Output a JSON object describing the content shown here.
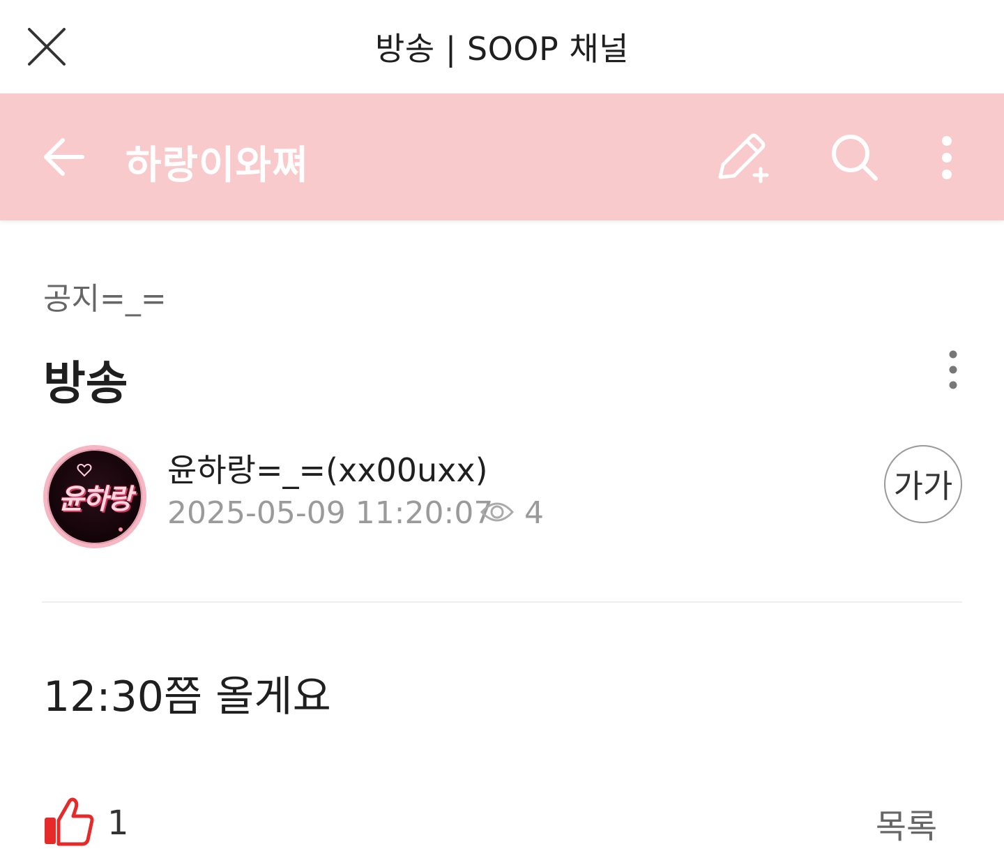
{
  "window": {
    "title": "방송 | SOOP 채널"
  },
  "channel_header": {
    "name": "하랑이와쪄",
    "background_color": "#f9cacb",
    "icons": [
      "back-arrow-icon",
      "write-post-icon",
      "search-icon",
      "more-vertical-icon"
    ]
  },
  "post": {
    "category": "공지=_=",
    "title": "방송",
    "author": "윤하랑=_=(xx00uxx)",
    "avatar_text": "윤하랑",
    "date": "2025-05-09 11:20:07",
    "views": "4",
    "font_size_label": "가가",
    "body": "12:30쯤 올게요",
    "likes": "1",
    "list_label": "목록"
  },
  "colors": {
    "like_red": "#e62a2a",
    "muted_text": "#9a9a9a"
  }
}
